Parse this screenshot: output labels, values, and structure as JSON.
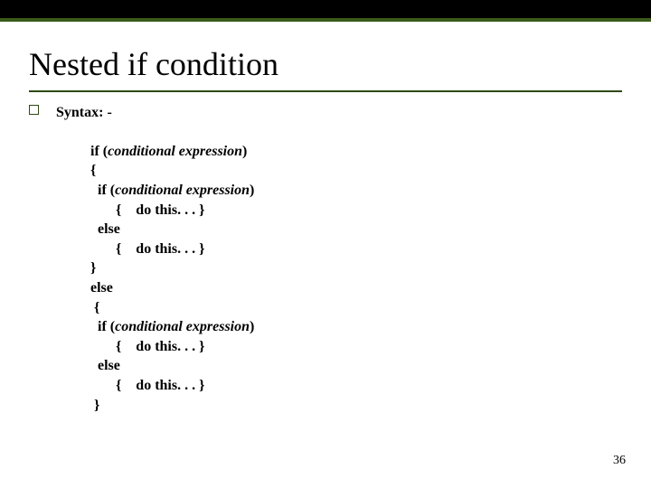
{
  "slide": {
    "title": "Nested if condition",
    "syntax_label": "Syntax: -",
    "page_number": "36"
  },
  "code": {
    "l1_pre": "if (",
    "l1_cond": "conditional expression",
    "l1_post": ")",
    "l2": "{",
    "l3_pre": "  if (",
    "l3_cond": "conditional expression",
    "l3_post": ")",
    "l4": "       {    do this. . . }",
    "l5": "  else",
    "l6": "       {    do this. . . }",
    "l7": "}",
    "l8": "else",
    "l9": " {",
    "l10_pre": "  if (",
    "l10_cond": "conditional expression",
    "l10_post": ")",
    "l11": "       {    do this. . . }",
    "l12": "  else",
    "l13": "       {    do this. . . }",
    "l14": " }"
  }
}
